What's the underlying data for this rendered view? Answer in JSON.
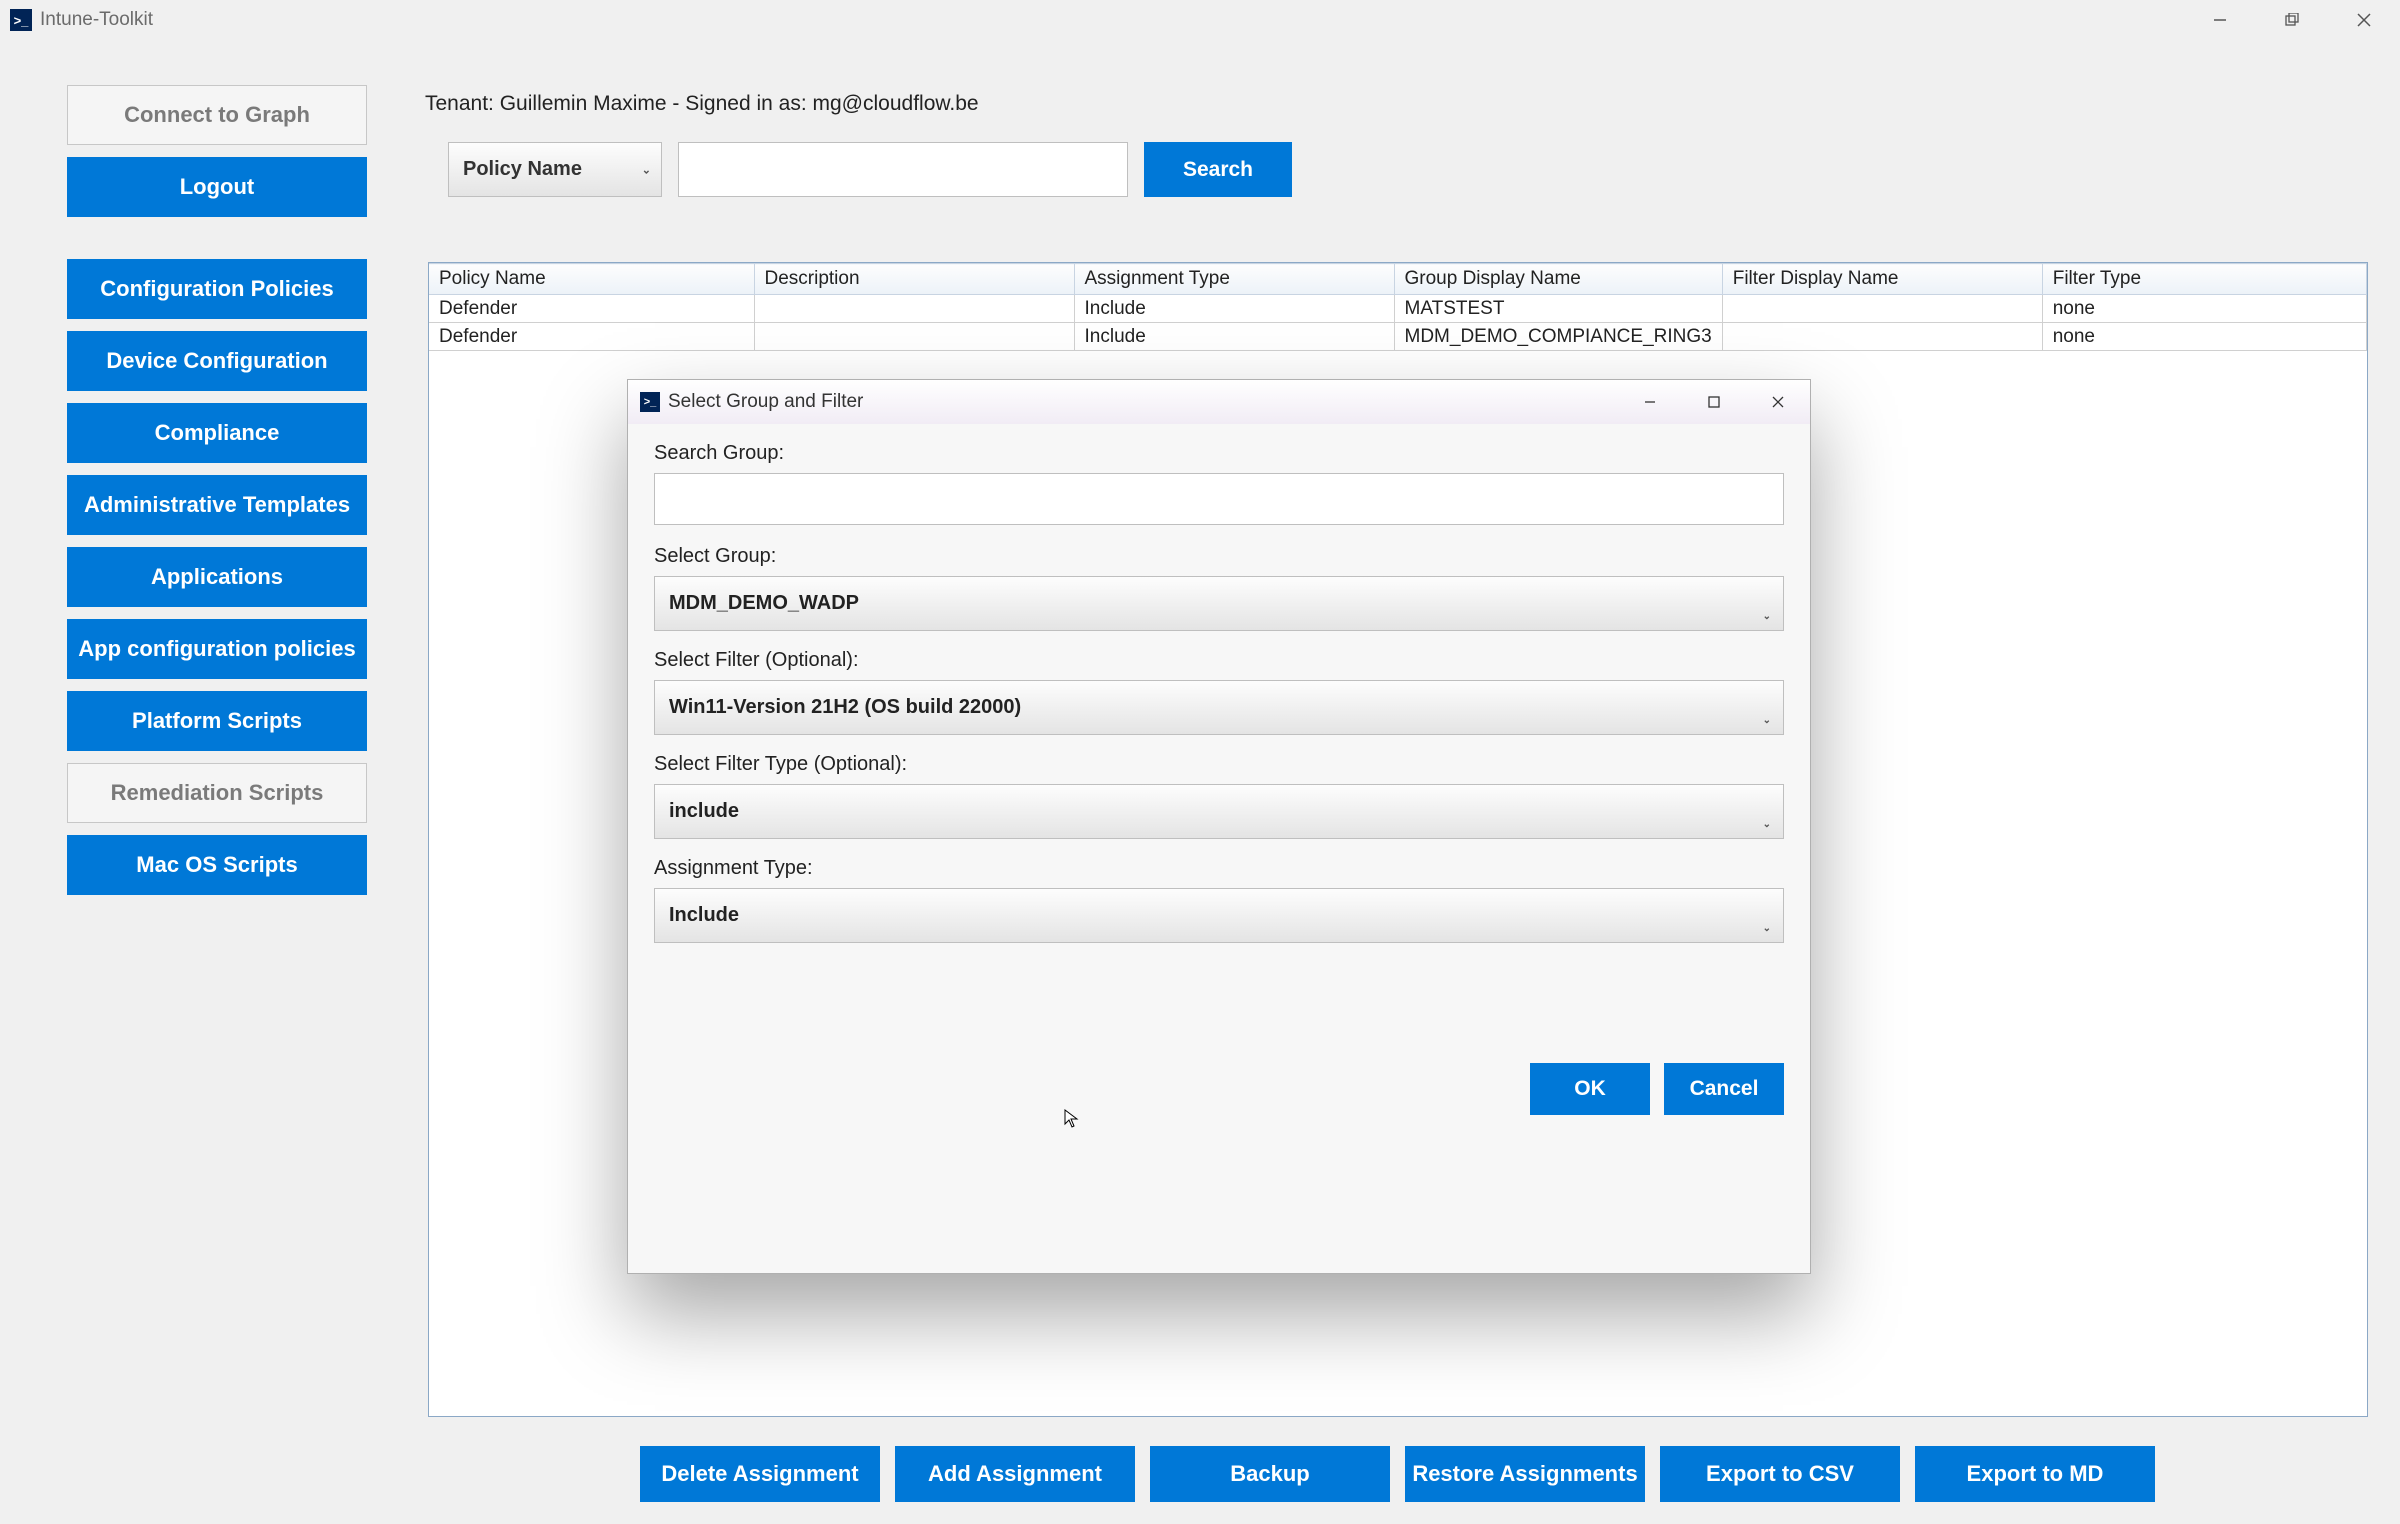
{
  "window": {
    "title": "Intune-Toolkit"
  },
  "sidebar": {
    "connect": "Connect to Graph",
    "logout": "Logout",
    "items": [
      "Configuration Policies",
      "Device Configuration",
      "Compliance",
      "Administrative Templates",
      "Applications",
      "App configuration policies",
      "Platform Scripts",
      "Remediation Scripts",
      "Mac OS Scripts"
    ]
  },
  "tenant_line": "Tenant: Guillemin Maxime - Signed in as: mg@cloudflow.be",
  "search": {
    "dropdown_value": "Policy Name",
    "input_value": "",
    "button": "Search"
  },
  "table": {
    "headers": [
      "Policy Name",
      "Description",
      "Assignment Type",
      "Group Display Name",
      "Filter Display Name",
      "Filter Type"
    ],
    "rows": [
      {
        "policy": "Defender",
        "desc": "",
        "atype": "Include",
        "group": "MATSTEST",
        "fdisp": "",
        "ftype": "none"
      },
      {
        "policy": "Defender",
        "desc": "",
        "atype": "Include",
        "group": "MDM_DEMO_COMPIANCE_RING3",
        "fdisp": "",
        "ftype": "none"
      }
    ]
  },
  "bottom": [
    "Delete Assignment",
    "Add Assignment",
    "Backup",
    "Restore Assignments",
    "Export to CSV",
    "Export to MD"
  ],
  "modal": {
    "title": "Select Group and Filter",
    "search_group_label": "Search Group:",
    "search_group_value": "",
    "select_group_label": "Select Group:",
    "select_group_value": "MDM_DEMO_WADP",
    "select_filter_label": "Select Filter (Optional):",
    "select_filter_value": "Win11-Version 21H2 (OS build 22000)",
    "select_filter_type_label": "Select Filter Type (Optional):",
    "select_filter_type_value": "include",
    "assignment_type_label": "Assignment Type:",
    "assignment_type_value": "Include",
    "ok": "OK",
    "cancel": "Cancel"
  }
}
